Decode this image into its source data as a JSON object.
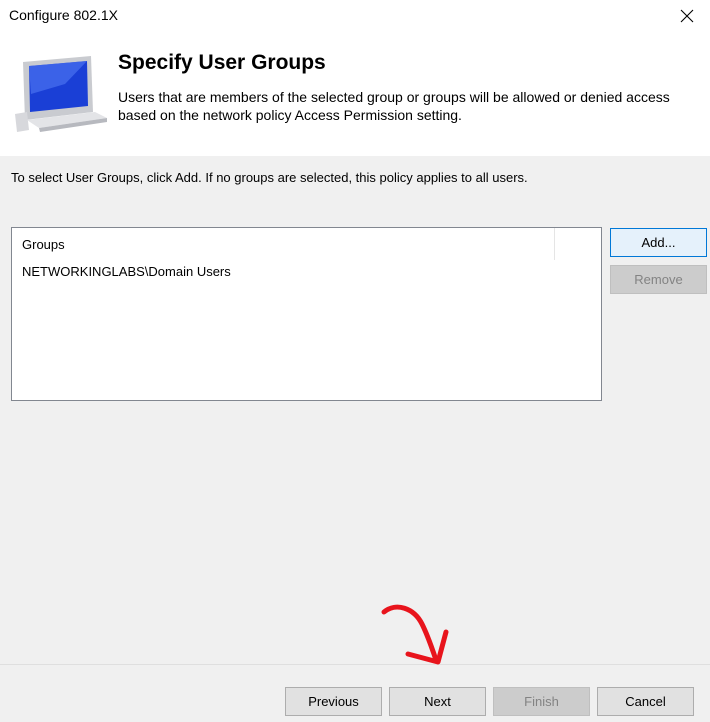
{
  "window": {
    "title": "Configure 802.1X"
  },
  "header": {
    "title": "Specify User Groups",
    "description": "Users that are members of the selected group or groups will be allowed or denied access based on the network policy Access Permission setting.",
    "icon": "network-computer-icon"
  },
  "body": {
    "instruction": "To select User Groups, click Add. If no groups are selected, this policy applies to all users.",
    "groups_list": {
      "column_header": "Groups",
      "rows": [
        "NETWORKINGLABS\\Domain Users"
      ]
    },
    "add_label": "Add...",
    "remove_label": "Remove"
  },
  "footer": {
    "previous_label": "Previous",
    "next_label": "Next",
    "finish_label": "Finish",
    "cancel_label": "Cancel"
  },
  "colors": {
    "annotation_arrow": "#e8141c",
    "icon_screen": "#1a3fd6"
  }
}
